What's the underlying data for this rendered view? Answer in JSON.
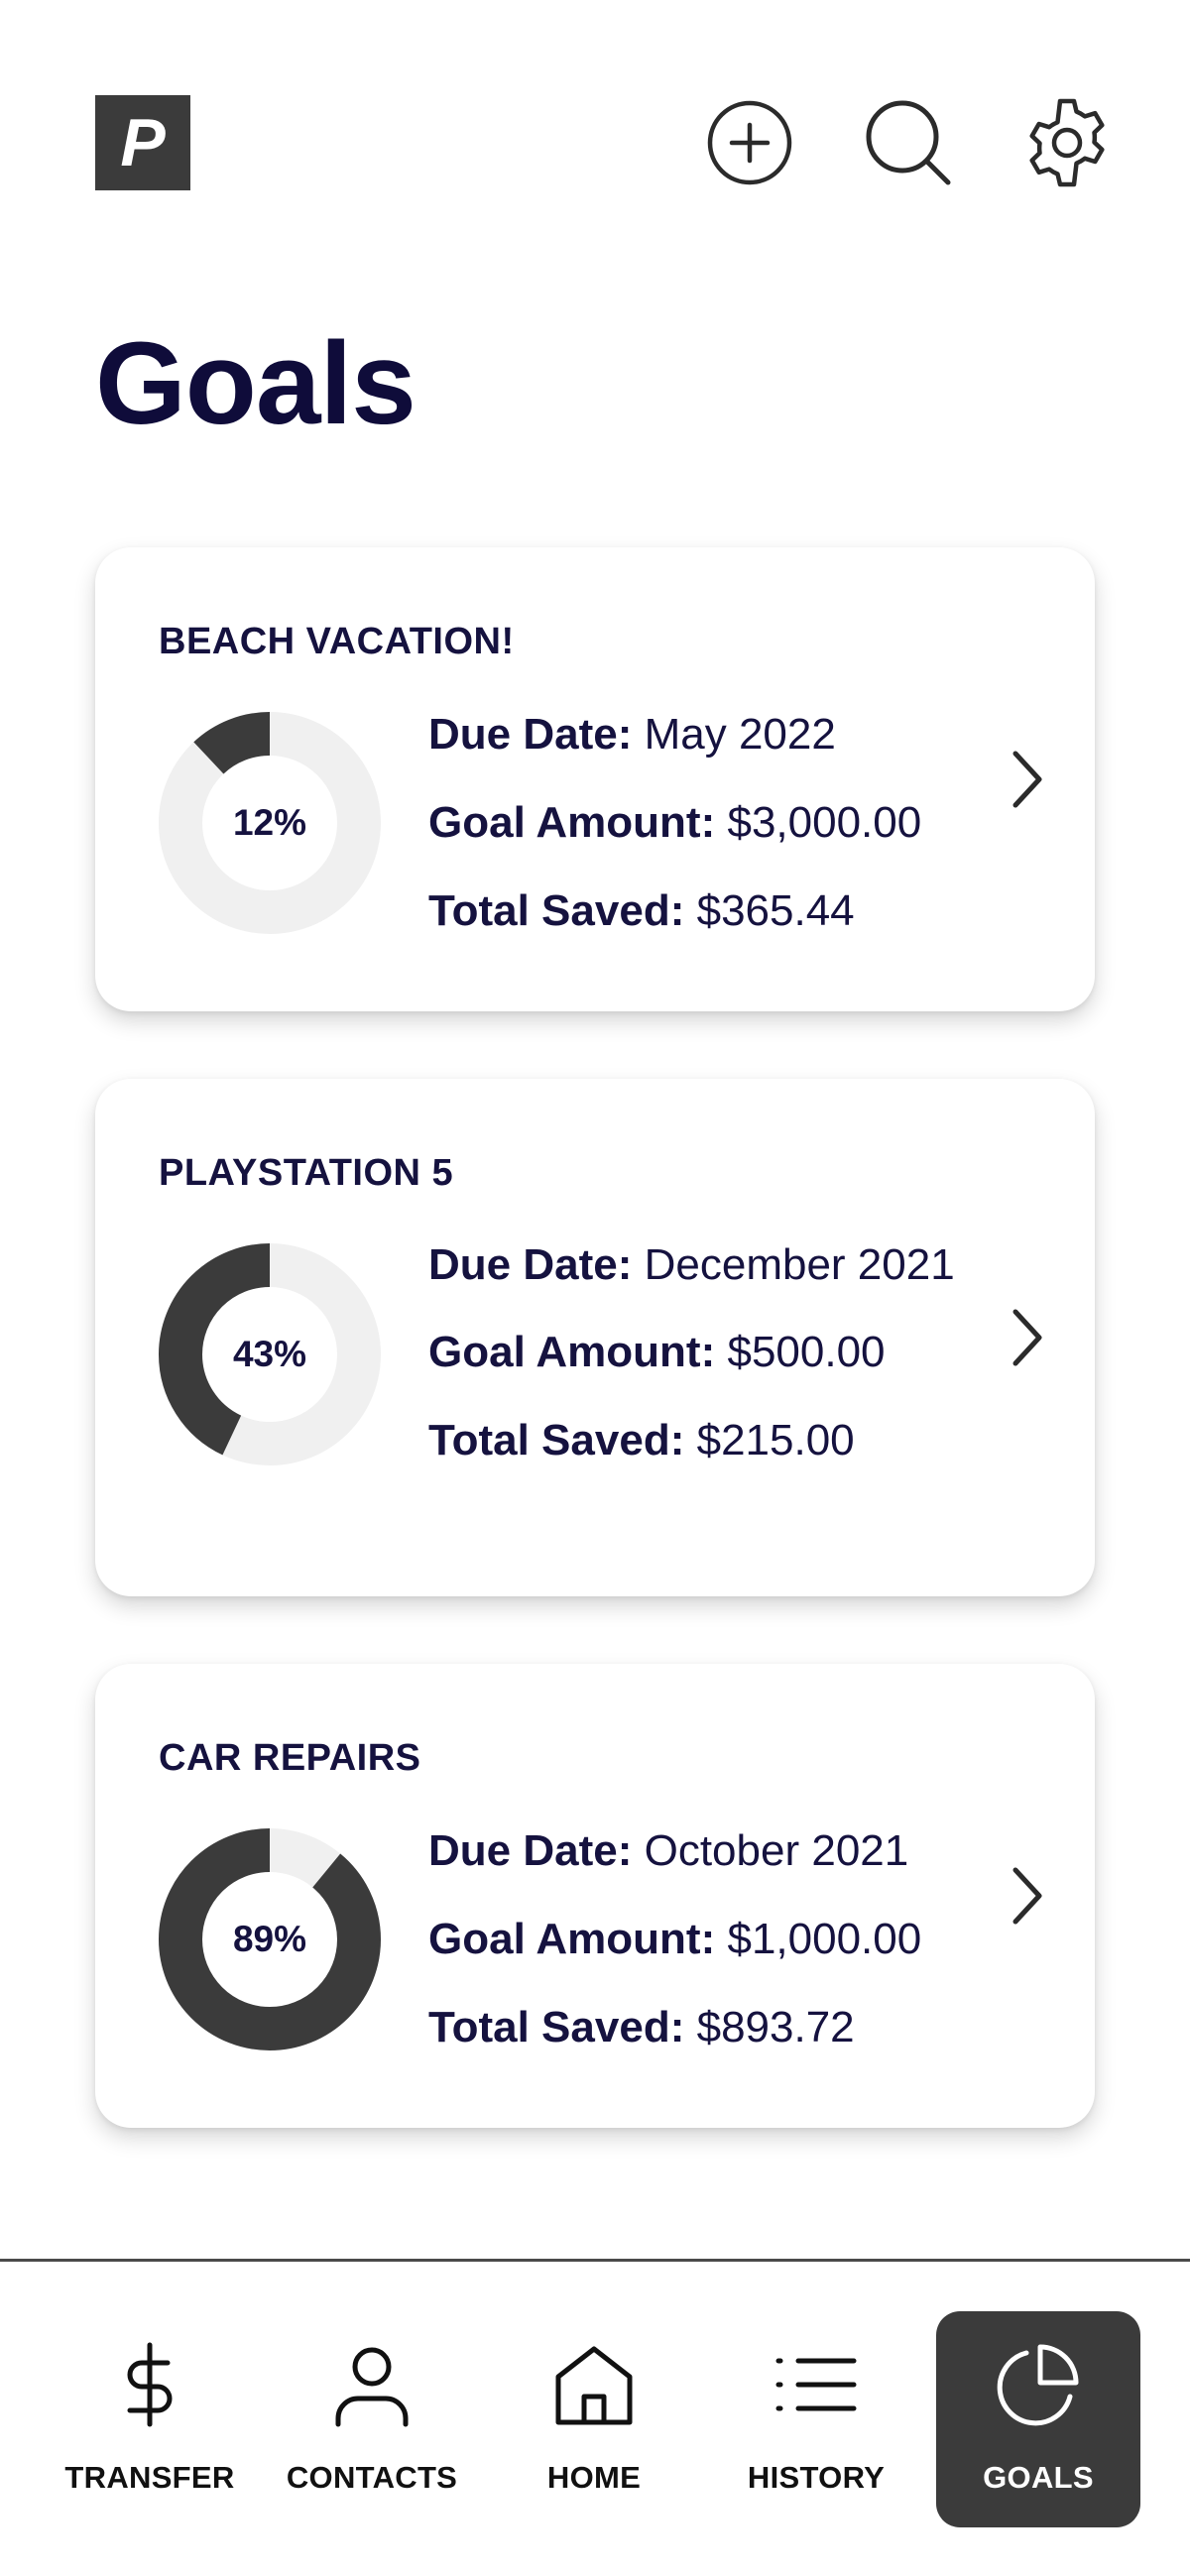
{
  "app": {
    "logo_letter": "P"
  },
  "header": {
    "icons": [
      "add-circle-icon",
      "search-icon",
      "gear-icon"
    ]
  },
  "page": {
    "title": "Goals"
  },
  "labels": {
    "due_date": "Due Date:",
    "goal_amount": "Goal Amount:",
    "total_saved": "Total Saved:"
  },
  "goals": [
    {
      "name": "BEACH VACATION!",
      "percent_label": "12%",
      "progress": 0.12,
      "due_date": "May 2022",
      "goal_amount": "$3,000.00",
      "total_saved": "$365.44"
    },
    {
      "name": "PLAYSTATION 5",
      "percent_label": "43%",
      "progress": 0.43,
      "due_date": "December 2021",
      "goal_amount": "$500.00",
      "total_saved": "$215.00"
    },
    {
      "name": "CAR REPAIRS",
      "percent_label": "89%",
      "progress": 0.89,
      "due_date": "October 2021",
      "goal_amount": "$1,000.00",
      "total_saved": "$893.72"
    }
  ],
  "nav": {
    "items": [
      {
        "label": "TRANSFER",
        "icon": "dollar-icon"
      },
      {
        "label": "CONTACTS",
        "icon": "person-icon"
      },
      {
        "label": "HOME",
        "icon": "home-icon"
      },
      {
        "label": "HISTORY",
        "icon": "list-icon"
      },
      {
        "label": "GOALS",
        "icon": "pie-chart-icon"
      }
    ],
    "active": "GOALS"
  },
  "colors": {
    "ring_fill": "#3b3b3b",
    "ring_track": "#f0f0f0",
    "text_primary": "#15123f",
    "active_nav_bg": "#3b3b3b"
  }
}
